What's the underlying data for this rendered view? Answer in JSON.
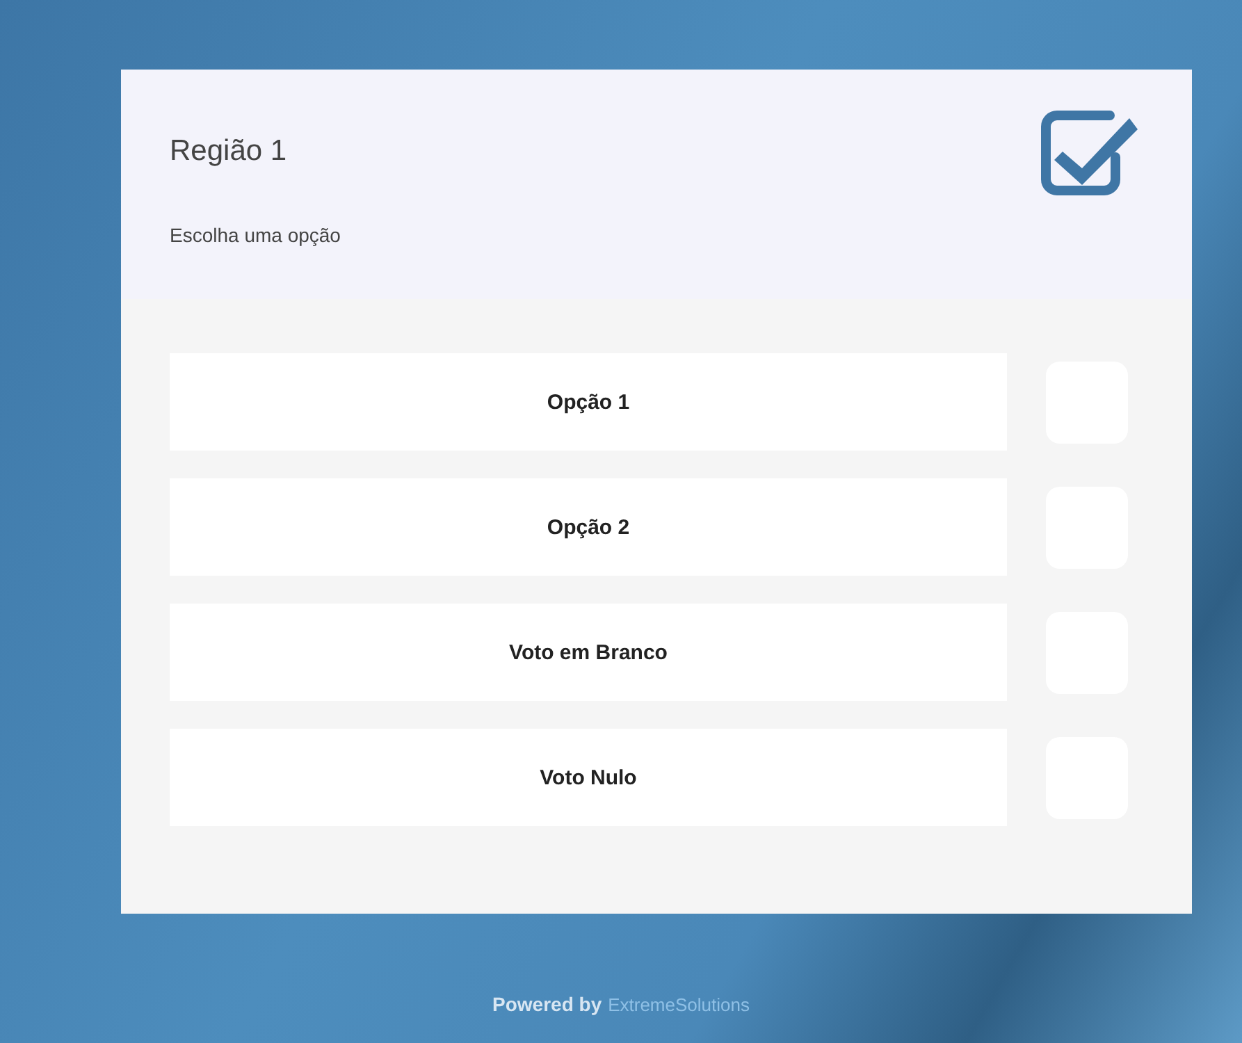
{
  "card": {
    "title": "Região 1",
    "subtitle": "Escolha uma opção"
  },
  "options": [
    {
      "label": "Opção 1",
      "checked": false
    },
    {
      "label": "Opção 2",
      "checked": false
    },
    {
      "label": "Voto em Branco",
      "checked": false
    },
    {
      "label": "Voto Nulo",
      "checked": false
    }
  ],
  "footer": {
    "prefix": "Powered by",
    "brand": "ExtremeSolutions"
  }
}
